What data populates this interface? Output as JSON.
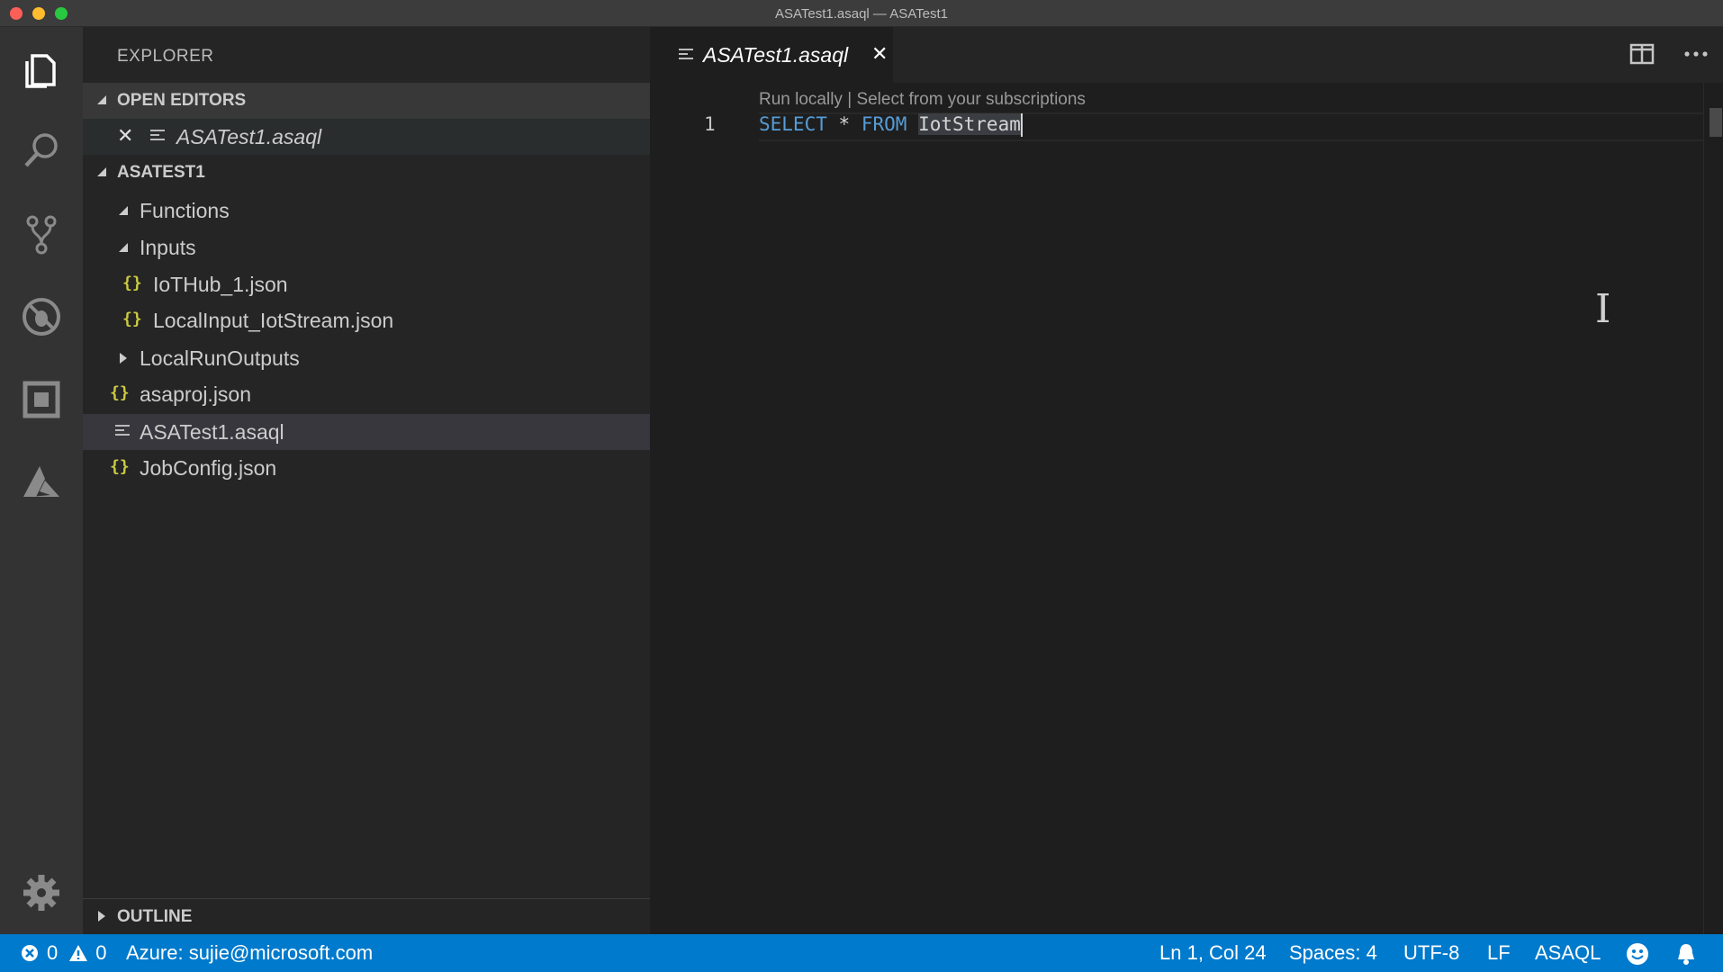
{
  "window": {
    "title": "ASATest1.asaql — ASATest1"
  },
  "activity_bar": {
    "items": [
      "explorer-icon",
      "search-icon",
      "source-control-icon",
      "debug-icon",
      "extensions-icon",
      "azure-icon"
    ],
    "settings": "gear-icon"
  },
  "sidebar": {
    "title": "EXPLORER",
    "open_editors": {
      "header": "OPEN EDITORS",
      "items": [
        {
          "label": "ASATest1.asaql"
        }
      ]
    },
    "project": {
      "header": "ASATEST1",
      "tree": [
        {
          "label": "Functions",
          "type": "folder",
          "expanded": true
        },
        {
          "label": "Inputs",
          "type": "folder",
          "expanded": true
        },
        {
          "label": "IoTHub_1.json",
          "type": "json"
        },
        {
          "label": "LocalInput_IotStream.json",
          "type": "json"
        },
        {
          "label": "LocalRunOutputs",
          "type": "folder",
          "expanded": false
        },
        {
          "label": "asaproj.json",
          "type": "json"
        },
        {
          "label": "ASATest1.asaql",
          "type": "asaql",
          "selected": true
        },
        {
          "label": "JobConfig.json",
          "type": "json"
        }
      ]
    },
    "outline_header": "OUTLINE"
  },
  "editor": {
    "tab": {
      "label": "ASATest1.asaql"
    },
    "codelens": {
      "run_locally": "Run locally",
      "separator": " | ",
      "select_subscription": "Select from your subscriptions"
    },
    "line_number": "1",
    "code": {
      "kw_select": "SELECT",
      "star": "*",
      "kw_from": "FROM",
      "ident": "IotStream"
    }
  },
  "status_bar": {
    "errors": "0",
    "warnings": "0",
    "account": "Azure: sujie@microsoft.com",
    "position": "Ln 1, Col 24",
    "spaces": "Spaces: 4",
    "encoding": "UTF-8",
    "eol": "LF",
    "language": "ASAQL"
  },
  "colors": {
    "accent": "#007acc",
    "keyword": "#569cd6",
    "json_brace": "#cbcb41"
  }
}
